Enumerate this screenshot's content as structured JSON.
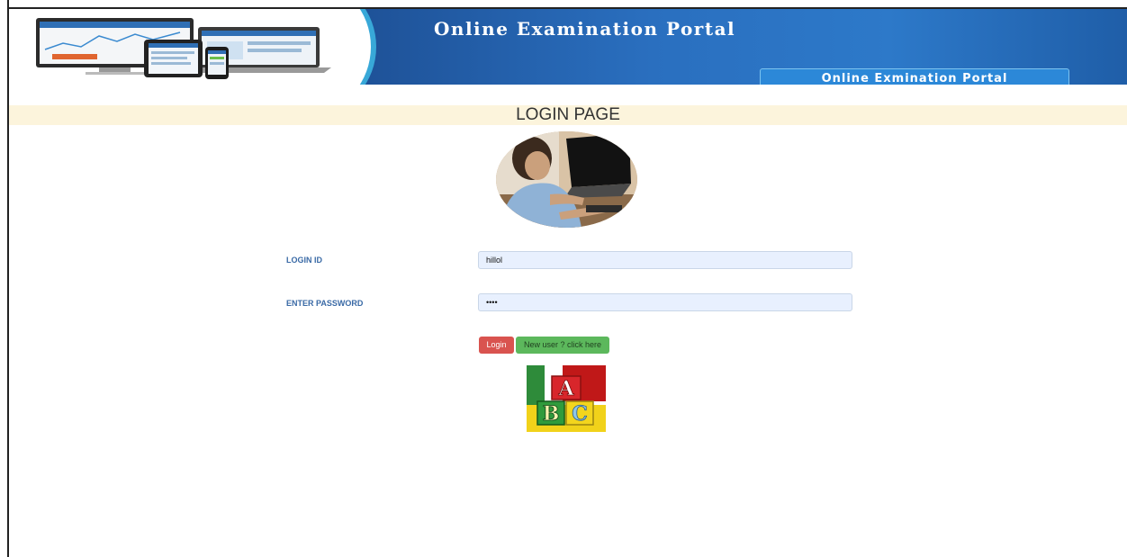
{
  "banner": {
    "title": "Online Examination Portal",
    "tag": "Online Exmination Portal",
    "logo_icon": "devices-illustration-icon"
  },
  "page": {
    "heading": "LOGIN PAGE"
  },
  "form": {
    "login_id_label": "LOGIN ID",
    "login_id_value": "hillol",
    "password_label": "ENTER PASSWORD",
    "password_value": "1234",
    "login_button": "Login",
    "new_user_button": "New user ? click here"
  },
  "images": {
    "avatar": "person-at-laptop-icon",
    "blocks": "abc-blocks-icon",
    "blocks_letters": [
      "A",
      "B",
      "C"
    ]
  },
  "colors": {
    "banner_blue": "#2a6fbf",
    "strip": "#fcf4dc",
    "label": "#3a6aa6",
    "login_button": "#d9534f",
    "new_user_button": "#5cb85c",
    "input_bg": "#e8f0fe"
  }
}
